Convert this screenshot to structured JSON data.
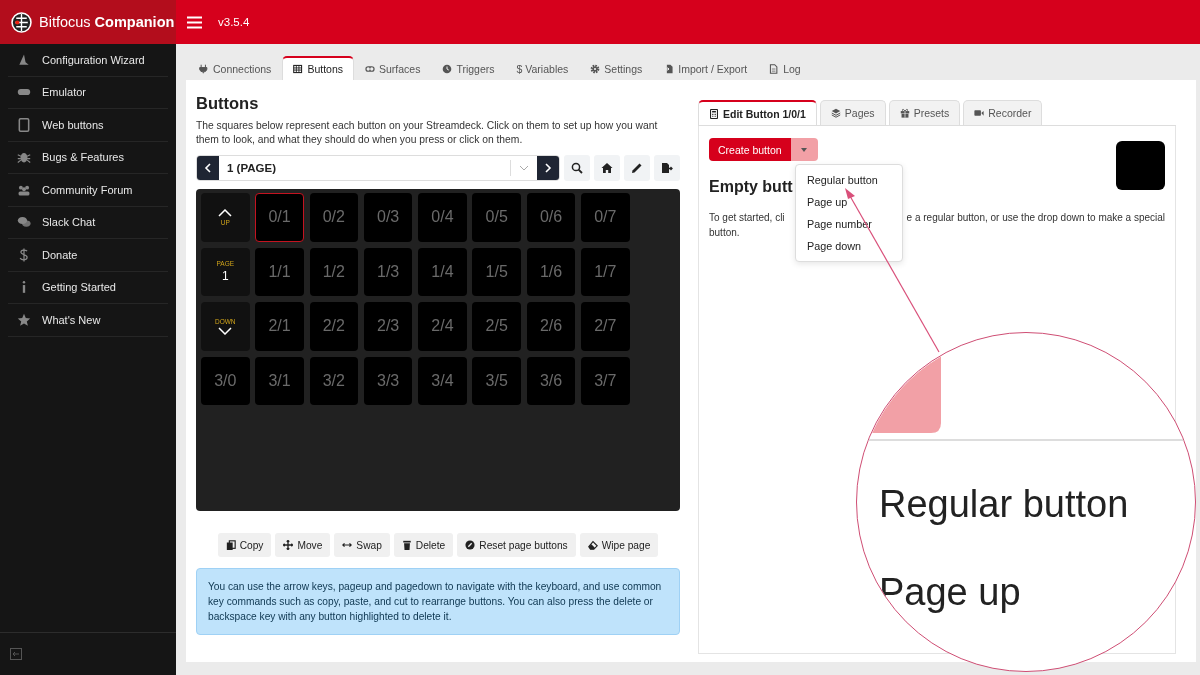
{
  "brand": "Bitfocus **Companion**",
  "version": "v3.5.4",
  "sidebar": {
    "items": [
      {
        "label": "Configuration Wizard"
      },
      {
        "label": "Emulator"
      },
      {
        "label": "Web buttons"
      },
      {
        "label": "Bugs & Features"
      },
      {
        "label": "Community Forum"
      },
      {
        "label": "Slack Chat"
      },
      {
        "label": "Donate"
      },
      {
        "label": "Getting Started"
      },
      {
        "label": "What's New"
      }
    ]
  },
  "tabs": [
    {
      "label": "Connections",
      "selected": false
    },
    {
      "label": "Buttons",
      "selected": true
    },
    {
      "label": "Surfaces",
      "selected": false
    },
    {
      "label": "Triggers",
      "selected": false
    },
    {
      "label": "$ Variables",
      "selected": false
    },
    {
      "label": "Settings",
      "selected": false
    },
    {
      "label": "Import / Export",
      "selected": false
    },
    {
      "label": "Log",
      "selected": false
    }
  ],
  "title": "Buttons",
  "description": "The squares below represent each button on your Streamdeck. Click on them to set up how you want them to look, and what they should do when you press or click on them.",
  "page_selector": {
    "value": "1 (PAGE)"
  },
  "grid": {
    "rows": [
      [
        {
          "kind": "up",
          "label": "UP"
        },
        {
          "kind": "slot",
          "text": "0/1",
          "selected": true
        },
        {
          "kind": "slot",
          "text": "0/2",
          "selected": false
        },
        {
          "kind": "slot",
          "text": "0/3",
          "selected": false
        },
        {
          "kind": "slot",
          "text": "0/4",
          "selected": false
        },
        {
          "kind": "slot",
          "text": "0/5",
          "selected": false
        },
        {
          "kind": "slot",
          "text": "0/6",
          "selected": false
        },
        {
          "kind": "slot",
          "text": "0/7",
          "selected": false
        }
      ],
      [
        {
          "kind": "page",
          "label": "PAGE",
          "value": "1"
        },
        {
          "kind": "slot",
          "text": "1/1",
          "selected": false
        },
        {
          "kind": "slot",
          "text": "1/2",
          "selected": false
        },
        {
          "kind": "slot",
          "text": "1/3",
          "selected": false
        },
        {
          "kind": "slot",
          "text": "1/4",
          "selected": false
        },
        {
          "kind": "slot",
          "text": "1/5",
          "selected": false
        },
        {
          "kind": "slot",
          "text": "1/6",
          "selected": false
        },
        {
          "kind": "slot",
          "text": "1/7",
          "selected": false
        }
      ],
      [
        {
          "kind": "down",
          "label": "DOWN"
        },
        {
          "kind": "slot",
          "text": "2/1",
          "selected": false
        },
        {
          "kind": "slot",
          "text": "2/2",
          "selected": false
        },
        {
          "kind": "slot",
          "text": "2/3",
          "selected": false
        },
        {
          "kind": "slot",
          "text": "2/4",
          "selected": false
        },
        {
          "kind": "slot",
          "text": "2/5",
          "selected": false
        },
        {
          "kind": "slot",
          "text": "2/6",
          "selected": false
        },
        {
          "kind": "slot",
          "text": "2/7",
          "selected": false
        }
      ],
      [
        {
          "kind": "slot",
          "text": "3/0",
          "selected": false
        },
        {
          "kind": "slot",
          "text": "3/1",
          "selected": false
        },
        {
          "kind": "slot",
          "text": "3/2",
          "selected": false
        },
        {
          "kind": "slot",
          "text": "3/3",
          "selected": false
        },
        {
          "kind": "slot",
          "text": "3/4",
          "selected": false
        },
        {
          "kind": "slot",
          "text": "3/5",
          "selected": false
        },
        {
          "kind": "slot",
          "text": "3/6",
          "selected": false
        },
        {
          "kind": "slot",
          "text": "3/7",
          "selected": false
        }
      ]
    ]
  },
  "actions": [
    "Copy",
    "Move",
    "Swap",
    "Delete",
    "Reset page buttons",
    "Wipe page"
  ],
  "info": "You can use the arrow keys, pageup and pagedown to navigate with the keyboard, and use common key commands such as copy, paste, and cut to rearrange buttons. You can also press the delete or backspace key with any button highlighted to delete it.",
  "editor": {
    "tabs": [
      {
        "label": "Edit Button 1/0/1",
        "selected": true
      },
      {
        "label": "Pages",
        "selected": false
      },
      {
        "label": "Presets",
        "selected": false
      },
      {
        "label": "Recorder",
        "selected": false
      }
    ],
    "create_button": "Create button",
    "heading": "Empty butt",
    "text_parts": [
      "To get started, cli",
      "e a regular button, or use the drop down to make a special",
      "button."
    ],
    "dropdown": [
      "Regular button",
      "Page up",
      "Page number",
      "Page down"
    ]
  },
  "magnifier": {
    "lines": [
      "Regular button",
      "Page up"
    ]
  }
}
